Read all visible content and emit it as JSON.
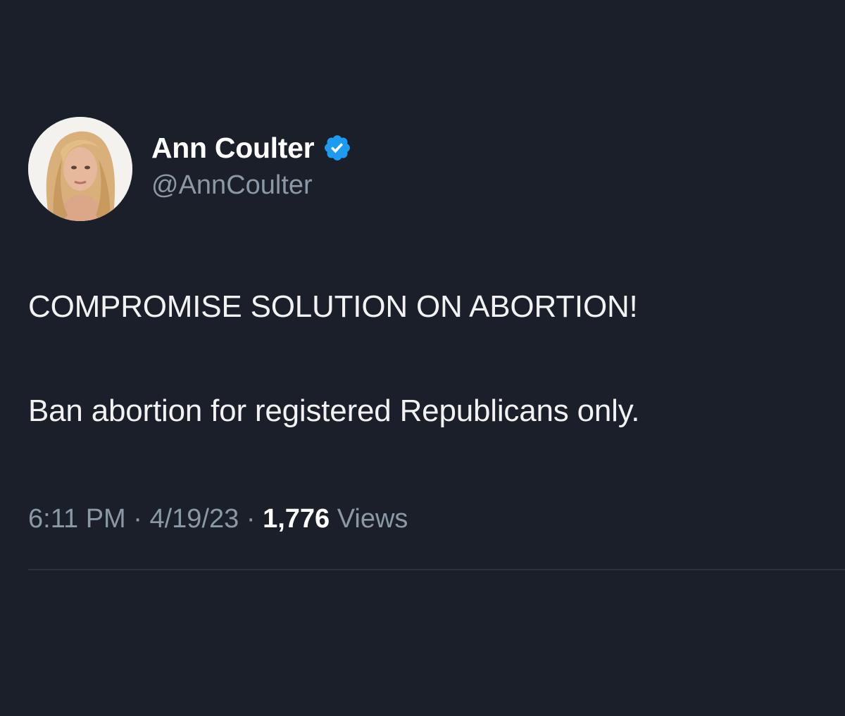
{
  "author": {
    "display_name": "Ann Coulter",
    "handle": "@AnnCoulter",
    "verified_icon": "verified-badge-icon",
    "avatar_icon": "avatar-photo"
  },
  "tweet": {
    "lines": [
      "COMPROMISE SOLUTION ON ABORTION!",
      "Ban abortion for registered Republicans only."
    ]
  },
  "meta": {
    "time": "6:11 PM",
    "separator": "·",
    "date": "4/19/23",
    "views_count": "1,776",
    "views_label": "Views"
  },
  "colors": {
    "background": "#1a1f29",
    "text_primary": "#ffffff",
    "text_secondary": "#8b98a5",
    "verified_blue": "#1d9bf0",
    "divider": "#2b323c"
  }
}
